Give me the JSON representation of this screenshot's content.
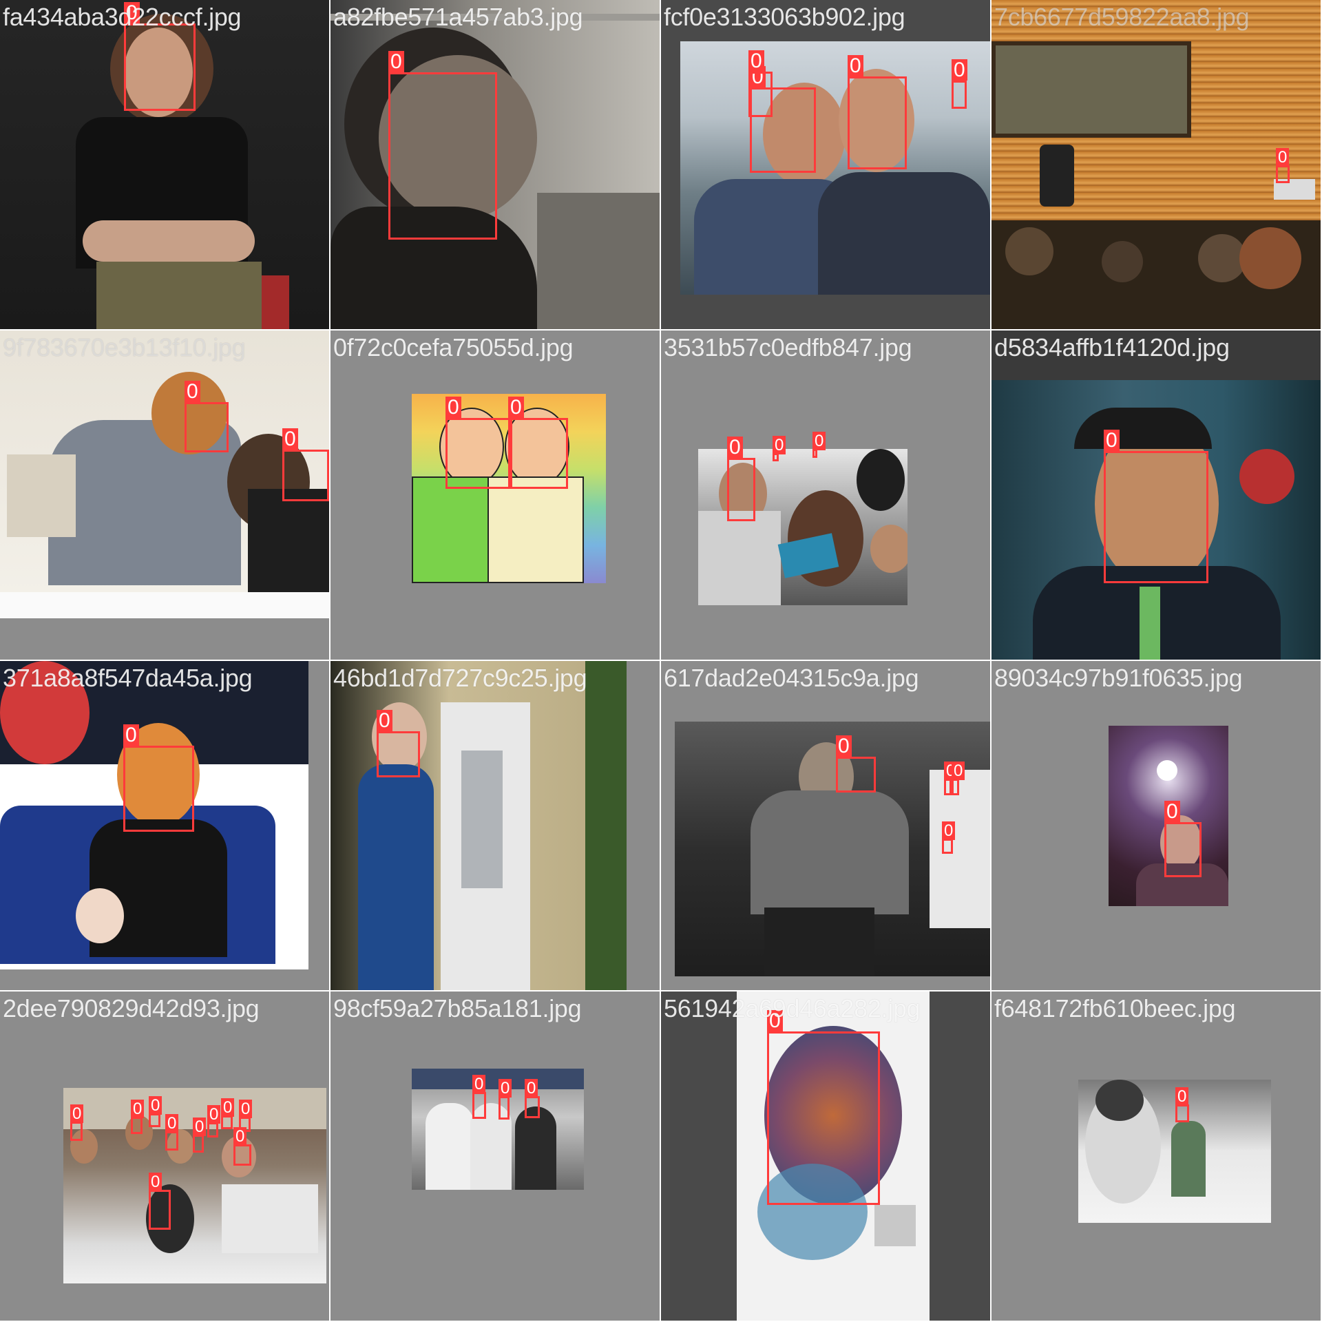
{
  "mosaic": {
    "box_color": "#ff3b3b",
    "background_color": "#8c8c8c",
    "tiles": [
      {
        "filename": "fa434aba3d22cccf.jpg",
        "boxes": [
          "0"
        ]
      },
      {
        "filename": "a82fbe571a457ab3.jpg",
        "boxes": [
          "0"
        ]
      },
      {
        "filename": "fcf0e3133063b902.jpg",
        "boxes": [
          "0",
          "0",
          "0",
          "0"
        ]
      },
      {
        "filename": "7cb6677d59822aa8.jpg",
        "boxes": [
          "0"
        ]
      },
      {
        "filename": "9f783670e3b13f10.jpg",
        "boxes": [
          "0",
          "0"
        ]
      },
      {
        "filename": "0f72c0cefa75055d.jpg",
        "boxes": [
          "0",
          "0"
        ]
      },
      {
        "filename": "3531b57c0edfb847.jpg",
        "boxes": [
          "0",
          "0",
          "0"
        ]
      },
      {
        "filename": "d5834affb1f4120d.jpg",
        "boxes": [
          "0"
        ]
      },
      {
        "filename": "371a8a8f547da45a.jpg",
        "boxes": [
          "0"
        ]
      },
      {
        "filename": "46bd1d7d727c9c25.jpg",
        "boxes": [
          "0"
        ]
      },
      {
        "filename": "617dad2e04315c9a.jpg",
        "boxes": [
          "0",
          "0",
          "0",
          "0"
        ]
      },
      {
        "filename": "89034c97b91f0635.jpg",
        "boxes": [
          "0"
        ]
      },
      {
        "filename": "2dee790829d42d93.jpg",
        "boxes": [
          "0",
          "0",
          "0",
          "0",
          "0",
          "0",
          "0",
          "0",
          "0",
          "0"
        ]
      },
      {
        "filename": "98cf59a27b85a181.jpg",
        "boxes": [
          "0",
          "0",
          "0"
        ]
      },
      {
        "filename": "561942a69d46a282.jpg",
        "boxes": [
          "0"
        ]
      },
      {
        "filename": "f648172fb610beec.jpg",
        "boxes": [
          "0"
        ]
      }
    ]
  }
}
